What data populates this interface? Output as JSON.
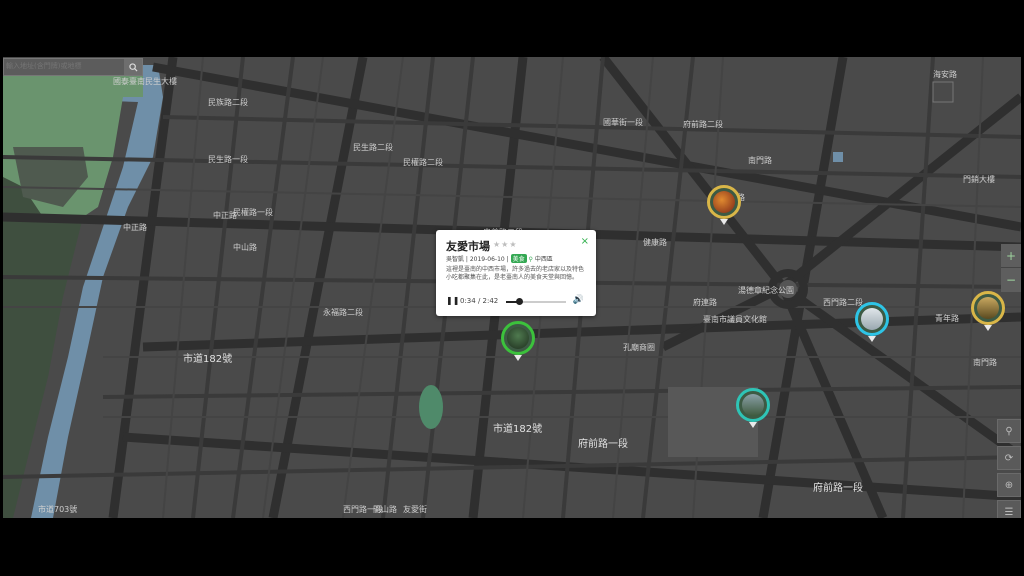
{
  "search": {
    "placeholder": "輸入地址(含門牌)或地標"
  },
  "map_labels": [
    {
      "text": "國泰臺南民生大樓",
      "cls": ""
    },
    {
      "text": "民族路二段",
      "cls": ""
    },
    {
      "text": "民生路二段",
      "cls": ""
    },
    {
      "text": "民生路一段",
      "cls": ""
    },
    {
      "text": "民權路二段",
      "cls": ""
    },
    {
      "text": "民權路一段",
      "cls": ""
    },
    {
      "text": "中正路",
      "cls": ""
    },
    {
      "text": "中正路",
      "cls": ""
    },
    {
      "text": "中山路",
      "cls": ""
    },
    {
      "text": "公園南路",
      "cls": ""
    },
    {
      "text": "湯德章紀念公園",
      "cls": ""
    },
    {
      "text": "臺南市議員文化館",
      "cls": ""
    },
    {
      "text": "孔廟商圈",
      "cls": ""
    },
    {
      "text": "南門路",
      "cls": ""
    },
    {
      "text": "市道182號",
      "cls": "big"
    },
    {
      "text": "市道182號",
      "cls": "big"
    },
    {
      "text": "府前路一段",
      "cls": "big"
    },
    {
      "text": "府前路一段",
      "cls": "big"
    },
    {
      "text": "西門路一段",
      "cls": ""
    },
    {
      "text": "開山路",
      "cls": ""
    },
    {
      "text": "友愛街",
      "cls": ""
    },
    {
      "text": "府前路二段",
      "cls": ""
    },
    {
      "text": "國華街一段",
      "cls": ""
    },
    {
      "text": "海安路",
      "cls": ""
    },
    {
      "text": "門銷大樓",
      "cls": ""
    },
    {
      "text": "西門路二段",
      "cls": ""
    },
    {
      "text": "青年路",
      "cls": ""
    },
    {
      "text": "南門路",
      "cls": ""
    },
    {
      "text": "市道703號",
      "cls": ""
    },
    {
      "text": "永福路二段",
      "cls": ""
    },
    {
      "text": "忠義路二段",
      "cls": ""
    },
    {
      "text": "健康路",
      "cls": ""
    },
    {
      "text": "府連路",
      "cls": ""
    }
  ],
  "popup": {
    "title": "友愛市場",
    "rating": "★★★",
    "close": "×",
    "author": "吳智凱",
    "date": "2019-06-10",
    "tag": "美食",
    "location": "中西區",
    "description": "這裡是臺南的中西市場，許多過去的老店家以及特色小吃都聚集在此，是老臺南人的美食天堂與回憶。",
    "player": {
      "pause": "❚❚",
      "time": "0:34 / 2:42",
      "progress": 0.21,
      "volume": "🔊"
    }
  },
  "zoom": {
    "in": "+",
    "out": "−"
  },
  "controls": [
    "⚲",
    "⟳",
    "⊕",
    "☰"
  ],
  "pins": [
    {
      "name": "pin-temple",
      "color": "#d9b648",
      "fill": "#8a3a1c"
    },
    {
      "name": "pin-youai-market",
      "color": "#3cc13c",
      "fill": "#2d4d2d"
    },
    {
      "name": "pin-museum",
      "color": "#2ec4b6",
      "fill": "#4f6a58"
    },
    {
      "name": "pin-landmark",
      "color": "#2ec4e6",
      "fill": "#c9d6de"
    },
    {
      "name": "pin-shrine",
      "color": "#d9b648",
      "fill": "#6b5a2a"
    }
  ]
}
